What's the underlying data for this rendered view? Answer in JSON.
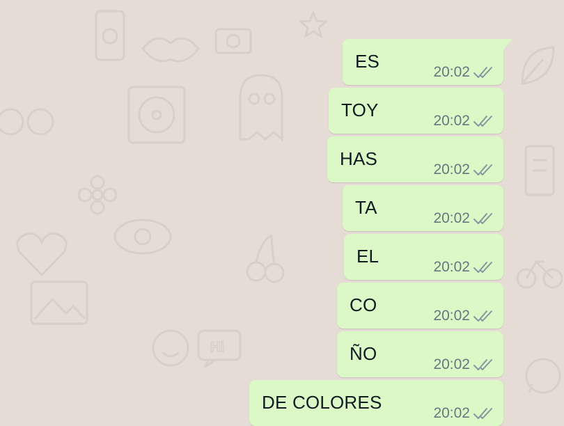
{
  "chat": {
    "background_color": "#e5ddd5",
    "bubble_color": "#dcf8c6",
    "tick_color": "#8696a0",
    "messages": [
      {
        "text": "ES",
        "time": "20:02",
        "status_icon": "double-check-icon"
      },
      {
        "text": "TOY",
        "time": "20:02",
        "status_icon": "double-check-icon"
      },
      {
        "text": "HAS",
        "time": "20:02",
        "status_icon": "double-check-icon"
      },
      {
        "text": "TA",
        "time": "20:02",
        "status_icon": "double-check-icon"
      },
      {
        "text": "EL",
        "time": "20:02",
        "status_icon": "double-check-icon"
      },
      {
        "text": "CO",
        "time": "20:02",
        "status_icon": "double-check-icon"
      },
      {
        "text": "ÑO",
        "time": "20:02",
        "status_icon": "double-check-icon"
      },
      {
        "text": "DE COLORES",
        "time": "20:02",
        "status_icon": "double-check-icon"
      }
    ]
  }
}
